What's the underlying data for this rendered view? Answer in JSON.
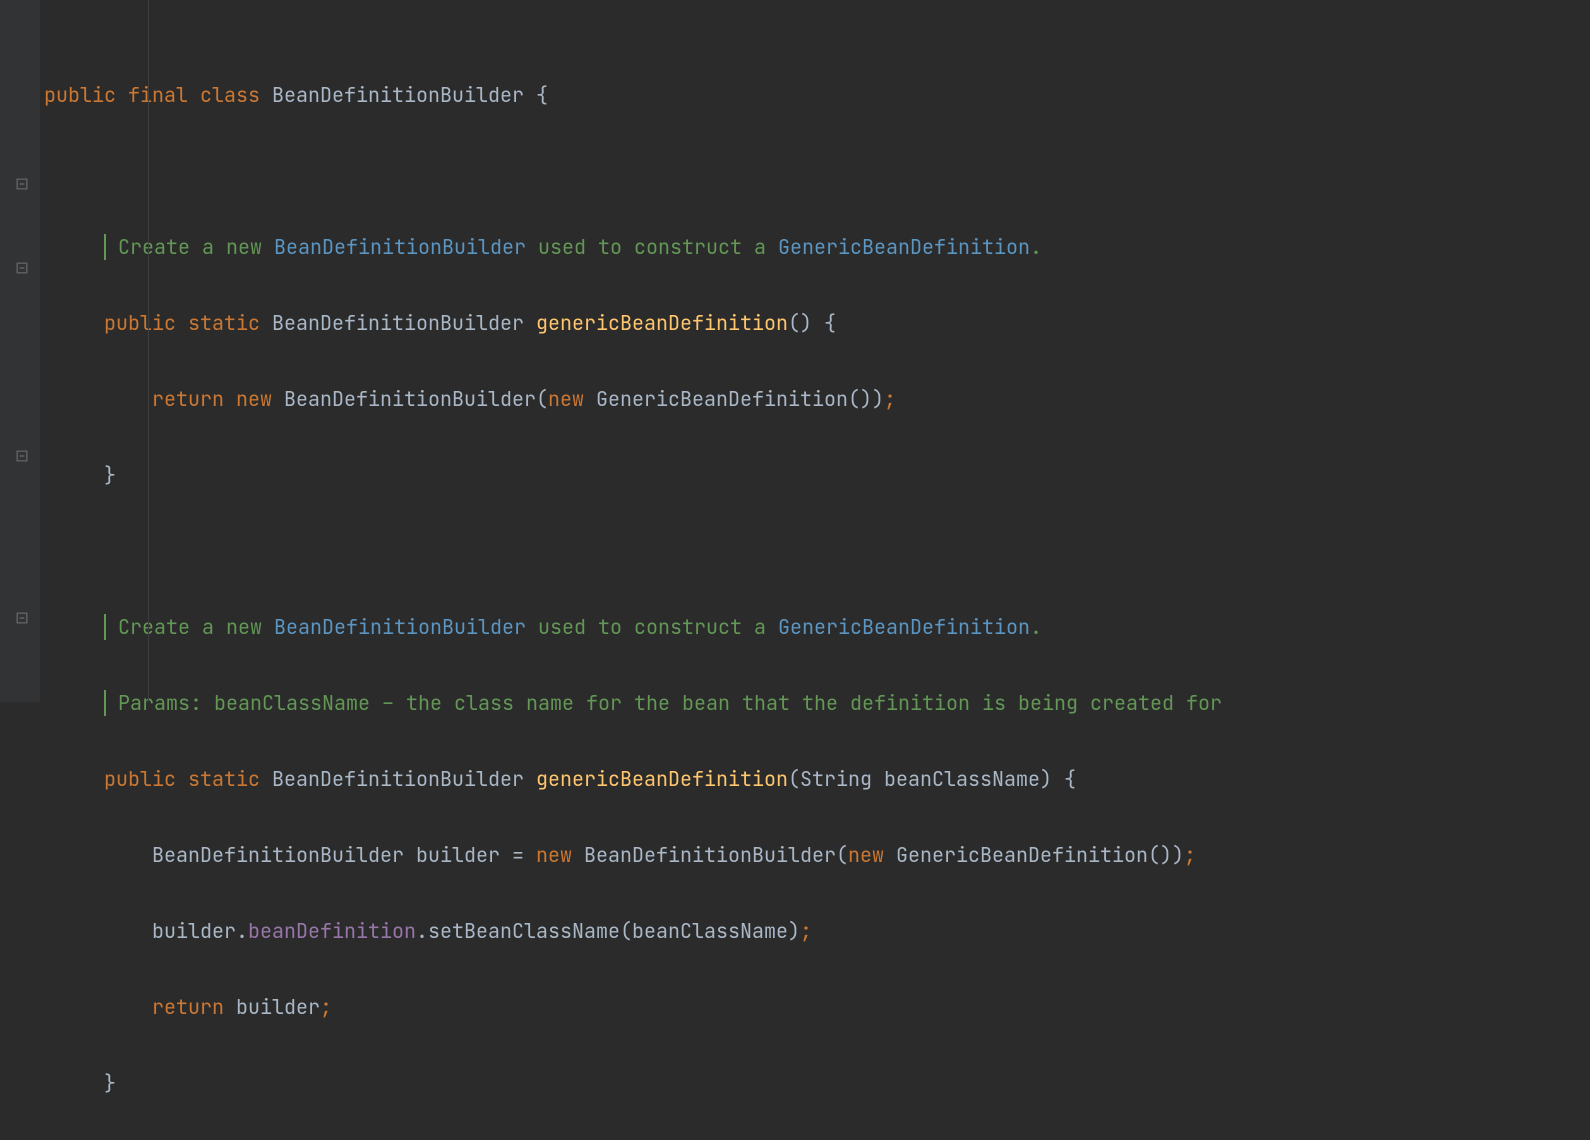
{
  "code": {
    "line1": {
      "public": "public",
      "final": "final",
      "class": "class",
      "className": "BeanDefinitionBuilder",
      "brace": "{"
    },
    "doc1": {
      "text1": "Create a new ",
      "link1": "BeanDefinitionBuilder",
      "text2": " used to construct a ",
      "link2": "GenericBeanDefinition",
      "text3": "."
    },
    "method1": {
      "public": "public",
      "static": "static",
      "returnType": "BeanDefinitionBuilder",
      "name": "genericBeanDefinition",
      "params": "()",
      "brace": "{",
      "return": "return",
      "new1": "new",
      "ctor1": "BeanDefinitionBuilder",
      "new2": "new",
      "ctor2": "GenericBeanDefinition",
      "closeBrace": "}"
    },
    "doc2": {
      "text1": "Create a new ",
      "link1": "BeanDefinitionBuilder",
      "text2": " used to construct a ",
      "link2": "GenericBeanDefinition",
      "text3": ".",
      "params": "Params: ",
      "paramName": "beanClassName",
      "paramDesc": " – the class name for the bean that the definition is being created for"
    },
    "method2": {
      "public": "public",
      "static": "static",
      "returnType": "BeanDefinitionBuilder",
      "name": "genericBeanDefinition",
      "paramType": "String",
      "paramName": "beanClassName",
      "brace": "{",
      "localType": "BeanDefinitionBuilder",
      "localName": "builder",
      "eq": "=",
      "new1": "new",
      "ctor1": "BeanDefinitionBuilder",
      "new2": "new",
      "ctor2": "GenericBeanDefinition",
      "builderRef": "builder",
      "dot1": ".",
      "field": "beanDefinition",
      "dot2": ".",
      "setCall": "setBeanClassName",
      "arg": "beanClassName",
      "return": "return",
      "retExpr": "builder",
      "closeBrace": "}"
    }
  }
}
